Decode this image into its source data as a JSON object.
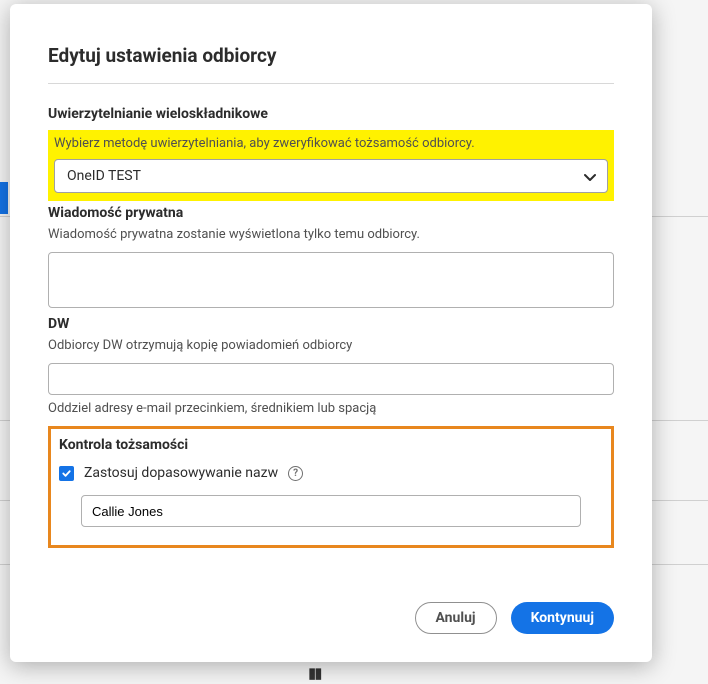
{
  "modal": {
    "title": "Edytuj ustawienia odbiorcy",
    "mfa": {
      "sectionLabel": "Uwierzytelnianie wieloskładnikowe",
      "hint": "Wybierz metodę uwierzytelniania, aby zweryfikować tożsamość odbiorcy.",
      "selected": "OneID TEST"
    },
    "privateMsg": {
      "sectionLabel": "Wiadomość prywatna",
      "hint": "Wiadomość prywatna zostanie wyświetlona tylko temu odbiorcy.",
      "value": ""
    },
    "cc": {
      "sectionLabel": "DW",
      "hint": "Odbiorcy DW otrzymują kopię powiadomień odbiorcy",
      "value": "",
      "belowHint": "Oddziel adresy e-mail przecinkiem, średnikiem lub spacją"
    },
    "identity": {
      "sectionLabel": "Kontrola tożsamości",
      "checkboxLabel": "Zastosuj dopasowywanie nazw",
      "checked": true,
      "nameValue": "Callie Jones"
    },
    "buttons": {
      "cancel": "Anuluj",
      "continue": "Kontynuuj"
    }
  }
}
